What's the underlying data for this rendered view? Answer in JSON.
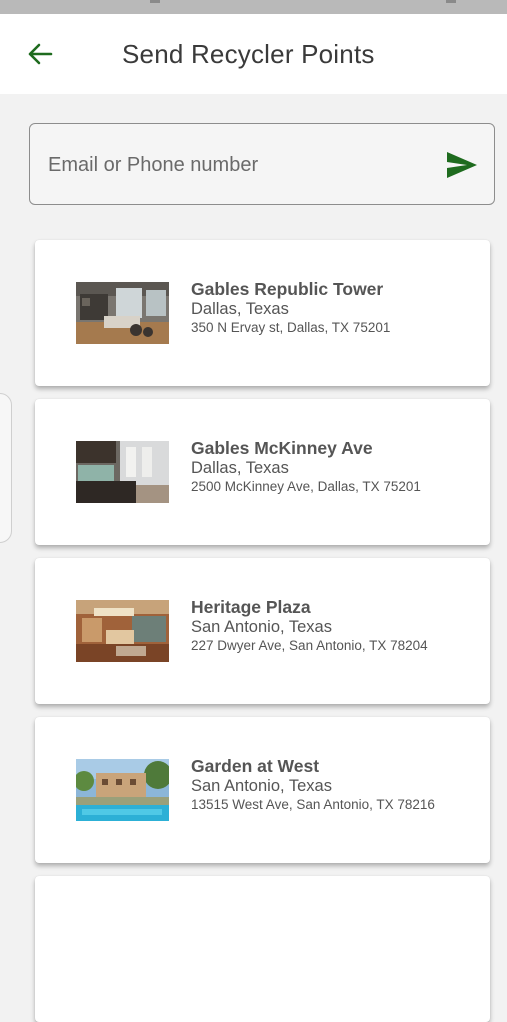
{
  "header": {
    "title": "Send Recycler Points"
  },
  "search": {
    "placeholder": "Email or Phone number",
    "value": ""
  },
  "colors": {
    "accent": "#1e6b1e"
  },
  "properties": [
    {
      "name": "Gables Republic Tower",
      "city": "Dallas, Texas",
      "address": "350 N Ervay st, Dallas, TX 75201"
    },
    {
      "name": "Gables McKinney Ave",
      "city": "Dallas, Texas",
      "address": "2500 McKinney Ave, Dallas, TX 75201"
    },
    {
      "name": "Heritage Plaza",
      "city": "San Antonio, Texas",
      "address": "227 Dwyer Ave, San Antonio, TX 78204"
    },
    {
      "name": "Garden at West",
      "city": "San Antonio, Texas",
      "address": "13515 West Ave, San Antonio, TX 78216"
    }
  ]
}
